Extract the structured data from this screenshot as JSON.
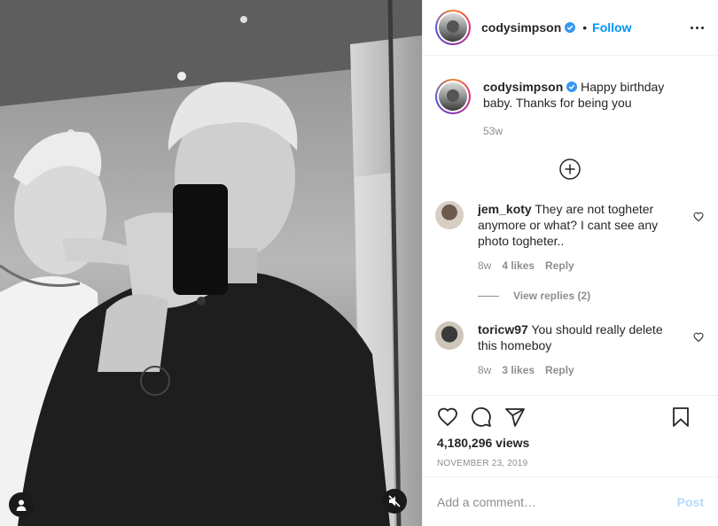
{
  "post": {
    "username": "codysimpson",
    "follow_label": "Follow",
    "dot": "•",
    "caption_text": "Happy birthday baby. Thanks for being you",
    "caption_time": "53w",
    "views": "4,180,296 views",
    "date": "NOVEMBER 23, 2019"
  },
  "comments": [
    {
      "username": "jem_koty",
      "text": "They are not togheter anymore or what? I cant see any photo togheter..",
      "time": "8w",
      "likes": "4 likes",
      "reply_label": "Reply",
      "view_replies": "View replies (2)"
    },
    {
      "username": "toricw97",
      "text": "You should really delete this homeboy",
      "time": "8w",
      "likes": "3 likes",
      "reply_label": "Reply"
    }
  ],
  "add_comment": {
    "placeholder": "Add a comment…",
    "post_label": "Post"
  },
  "colors": {
    "accent": "#0095f6",
    "post_disabled": "#b3dbff",
    "muted": "#8e8e8e",
    "text": "#262626"
  },
  "icons": [
    "user-tag-icon",
    "mute-icon",
    "verified-badge-icon",
    "more-options-icon",
    "load-more-icon",
    "heart-icon",
    "comment-icon",
    "share-icon",
    "bookmark-icon"
  ]
}
